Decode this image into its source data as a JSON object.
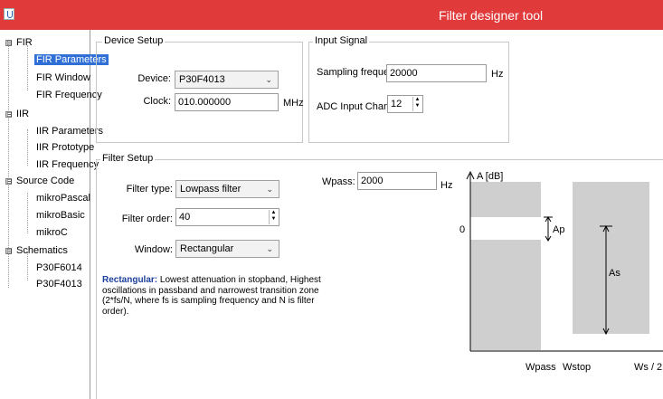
{
  "window": {
    "title": "Filter designer tool"
  },
  "tree": {
    "groups": [
      {
        "label": "FIR",
        "expander": "⊟",
        "items": [
          "FIR Parameters",
          "FIR Window",
          "FIR Frequency"
        ]
      },
      {
        "label": "IIR",
        "expander": "⊟",
        "items": [
          "IIR Parameters",
          "IIR Prototype",
          "IIR Frequency"
        ]
      },
      {
        "label": "Source Code",
        "expander": "⊟",
        "items": [
          "mikroPascal",
          "mikroBasic",
          "mikroC"
        ]
      },
      {
        "label": "Schematics",
        "expander": "⊟",
        "items": [
          "P30F6014",
          "P30F4013"
        ]
      }
    ],
    "selected": "FIR Parameters"
  },
  "device_setup": {
    "title": "Device Setup",
    "device_label": "Device:",
    "device_value": "P30F4013",
    "clock_label": "Clock:",
    "clock_value": "010.000000",
    "clock_unit": "MHz"
  },
  "input_signal": {
    "title": "Input Signal",
    "sampling_label": "Sampling frequency:",
    "sampling_value": "20000",
    "sampling_unit": "Hz",
    "adc_label": "ADC Input Channel",
    "adc_value": "12"
  },
  "filter_setup": {
    "title": "Filter Setup",
    "type_label": "Filter type:",
    "type_value": "Lowpass filter",
    "order_label": "Filter order:",
    "order_value": "40",
    "window_label": "Window:",
    "window_value": "Rectangular",
    "wpass_label": "Wpass:",
    "wpass_value": "2000",
    "wpass_unit": "Hz",
    "description_title": "Rectangular:",
    "description_text": "Lowest attenuation in stopband, Highest oscillations in passband and narrowest transition zone (2*fs/N, where fs is sampling frequency and N is filter order)."
  },
  "diagram": {
    "y_axis_label": "A [dB]",
    "zero_label": "0",
    "ap_label": "Ap",
    "as_label": "As",
    "x_labels": [
      "Wpass",
      "Wstop",
      "Ws / 2"
    ],
    "fill_color": "#cfcfcf"
  }
}
